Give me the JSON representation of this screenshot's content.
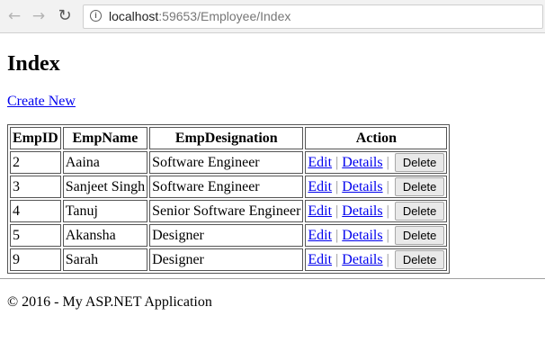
{
  "browser": {
    "url_host": "localhost",
    "url_path": ":59653/Employee/Index",
    "icons": {
      "back": "back-arrow-icon",
      "forward": "forward-arrow-icon",
      "reload": "reload-icon",
      "info": "info-icon"
    }
  },
  "page": {
    "title": "Index",
    "create_link": "Create New"
  },
  "table": {
    "headers": [
      "EmpID",
      "EmpName",
      "EmpDesignation",
      "Action"
    ],
    "rows": [
      {
        "id": "2",
        "name": "Aaina",
        "designation": "Software Engineer"
      },
      {
        "id": "3",
        "name": "Sanjeet Singh",
        "designation": "Software Engineer"
      },
      {
        "id": "4",
        "name": "Tanuj",
        "designation": "Senior Software Engineer"
      },
      {
        "id": "5",
        "name": "Akansha",
        "designation": "Designer"
      },
      {
        "id": "9",
        "name": "Sarah",
        "designation": "Designer"
      }
    ],
    "actions": {
      "edit": "Edit",
      "details": "Details",
      "delete": "Delete",
      "separator": "|"
    }
  },
  "footer": {
    "text": "© 2016 - My ASP.NET Application"
  },
  "colors": {
    "link": "#0000ee",
    "browser_bar": "#f2f2f2"
  }
}
